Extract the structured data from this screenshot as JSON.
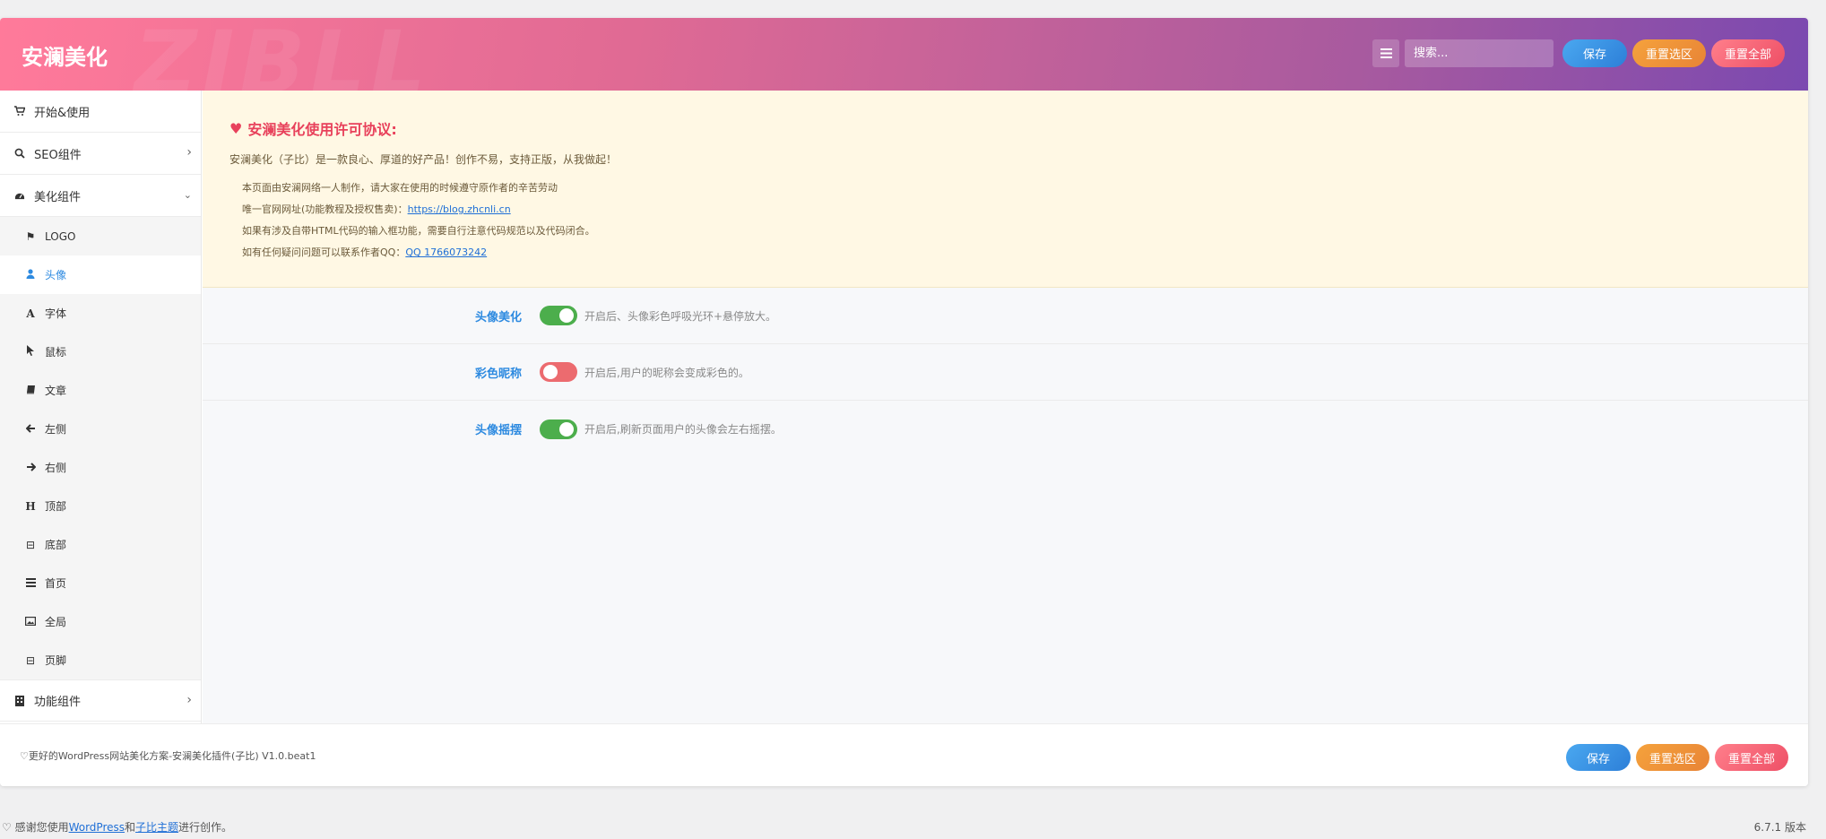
{
  "header": {
    "title": "安澜美化",
    "watermark": "ZIBLL",
    "search_placeholder": "搜索...",
    "save": "保存",
    "reset_section": "重置选区",
    "reset_all": "重置全部"
  },
  "sidebar": {
    "top_items": [
      {
        "label": "开始&使用",
        "icon": "cart-icon"
      },
      {
        "label": "SEO组件",
        "icon": "search-icon"
      },
      {
        "label": "美化组件",
        "icon": "dashboard-icon"
      }
    ],
    "sub_items": [
      {
        "label": "LOGO",
        "icon": "flag-icon"
      },
      {
        "label": "头像",
        "icon": "user-icon",
        "active": true
      },
      {
        "label": "字体",
        "icon": "font-icon"
      },
      {
        "label": "鼠标",
        "icon": "pointer-icon"
      },
      {
        "label": "文章",
        "icon": "book-icon"
      },
      {
        "label": "左侧",
        "icon": "arrow-left-icon"
      },
      {
        "label": "右侧",
        "icon": "arrow-right-icon"
      },
      {
        "label": "顶部",
        "icon": "header-icon"
      },
      {
        "label": "底部",
        "icon": "window-icon"
      },
      {
        "label": "首页",
        "icon": "list-icon"
      },
      {
        "label": "全局",
        "icon": "image-icon"
      },
      {
        "label": "页脚",
        "icon": "window-icon"
      }
    ],
    "bottom_item": {
      "label": "功能组件",
      "icon": "building-icon"
    }
  },
  "notice": {
    "title": "安澜美化使用许可协议:",
    "lead": "安澜美化（子比）是一款良心、厚道的好产品！创作不易，支持正版，从我做起！",
    "line1": "本页面由安澜网络一人制作，请大家在使用的时候遵守原作者的辛苦劳动",
    "line2_prefix": "唯一官网网址(功能教程及授权售卖)：",
    "line2_link": "https://blog.zhcnli.cn",
    "line3": "如果有涉及自带HTML代码的输入框功能，需要自行注意代码规范以及代码闭合。",
    "line4_prefix": "如有任何疑问问题可以联系作者QQ：",
    "line4_link": "QQ 1766073242"
  },
  "options": [
    {
      "label": "头像美化",
      "on": true,
      "desc": "开启后、头像彩色呼吸光环+悬停放大。"
    },
    {
      "label": "彩色昵称",
      "on": false,
      "desc": "开启后,用户的昵称会变成彩色的。"
    },
    {
      "label": "头像摇摆",
      "on": true,
      "desc": "开启后,刷新页面用户的头像会左右摇摆。"
    }
  ],
  "footer": {
    "version": "♡更好的WordPress网站美化方案-安澜美化插件(子比) V1.0.beat1",
    "save": "保存",
    "reset_section": "重置选区",
    "reset_all": "重置全部"
  },
  "bottombar": {
    "prefix": "♡ 感谢您使用",
    "link1": "WordPress",
    "mid": "和",
    "link2": "子比主题",
    "suffix": "进行创作。",
    "version": "6.7.1 版本"
  }
}
